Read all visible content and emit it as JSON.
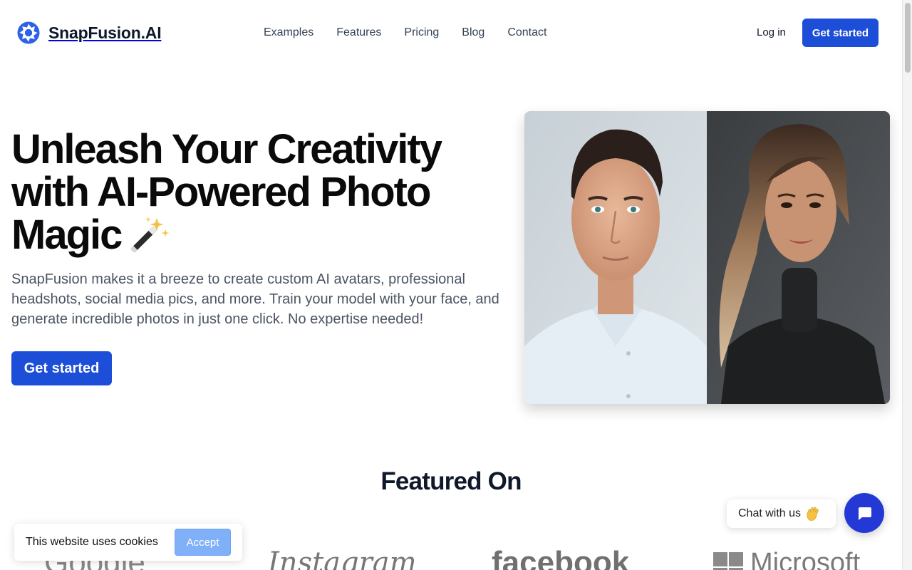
{
  "brand": {
    "name": "SnapFusion.AI",
    "logo_icon": "aperture-icon",
    "accent": "#1d4ed8"
  },
  "nav": {
    "items": [
      {
        "label": "Examples"
      },
      {
        "label": "Features"
      },
      {
        "label": "Pricing"
      },
      {
        "label": "Blog"
      },
      {
        "label": "Contact"
      }
    ],
    "login_label": "Log in",
    "cta_label": "Get started"
  },
  "hero": {
    "title_line1": "Unleash Your Creativity",
    "title_line2": "with AI-Powered Photo",
    "title_line3": "Magic",
    "title_emoji": "magic-wand-icon",
    "subtitle": "SnapFusion makes it a breeze to create custom AI avatars, professional headshots, social media pics, and more. Train your model with your face, and generate incredible photos in just one click. No expertise needed!",
    "cta_label": "Get started",
    "image": "ai-portrait-comparison"
  },
  "featured": {
    "title": "Featured On",
    "logos": [
      {
        "name": "Google"
      },
      {
        "name": "Instagram"
      },
      {
        "name": "facebook"
      },
      {
        "name": "Microsoft"
      }
    ]
  },
  "cookie_banner": {
    "text": "This website uses cookies",
    "accept_label": "Accept"
  },
  "chat": {
    "bubble_text": "Chat with us",
    "bubble_icon": "waving-hand-icon",
    "button_icon": "chat-icon",
    "button_color": "#2438d6"
  }
}
